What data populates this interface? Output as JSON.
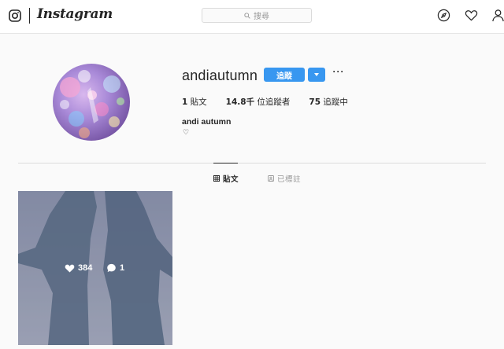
{
  "nav": {
    "brand": "Instagram",
    "search_placeholder": "搜尋",
    "icons": [
      "instagram-logo-icon",
      "search-icon",
      "compass-icon",
      "heart-icon",
      "person-icon"
    ]
  },
  "profile": {
    "username": "andiautumn",
    "follow_label": "追蹤",
    "more_label": "···",
    "stats": [
      {
        "value": "1",
        "label": "貼文"
      },
      {
        "value": "14.8千",
        "label": "位追蹤者"
      },
      {
        "value": "75",
        "label": "追蹤中"
      }
    ],
    "full_name": "andi autumn",
    "bio": "♡"
  },
  "tabs": [
    {
      "label": "貼文",
      "icon": "grid-icon",
      "active": true
    },
    {
      "label": "已標註",
      "icon": "tag-icon",
      "active": false
    }
  ],
  "posts": [
    {
      "likes": "384",
      "comments": "1"
    }
  ],
  "colors": {
    "accent": "#3897f0",
    "border": "#dbdbdb",
    "background": "#fafafa",
    "text": "#262626",
    "muted": "#999999"
  }
}
